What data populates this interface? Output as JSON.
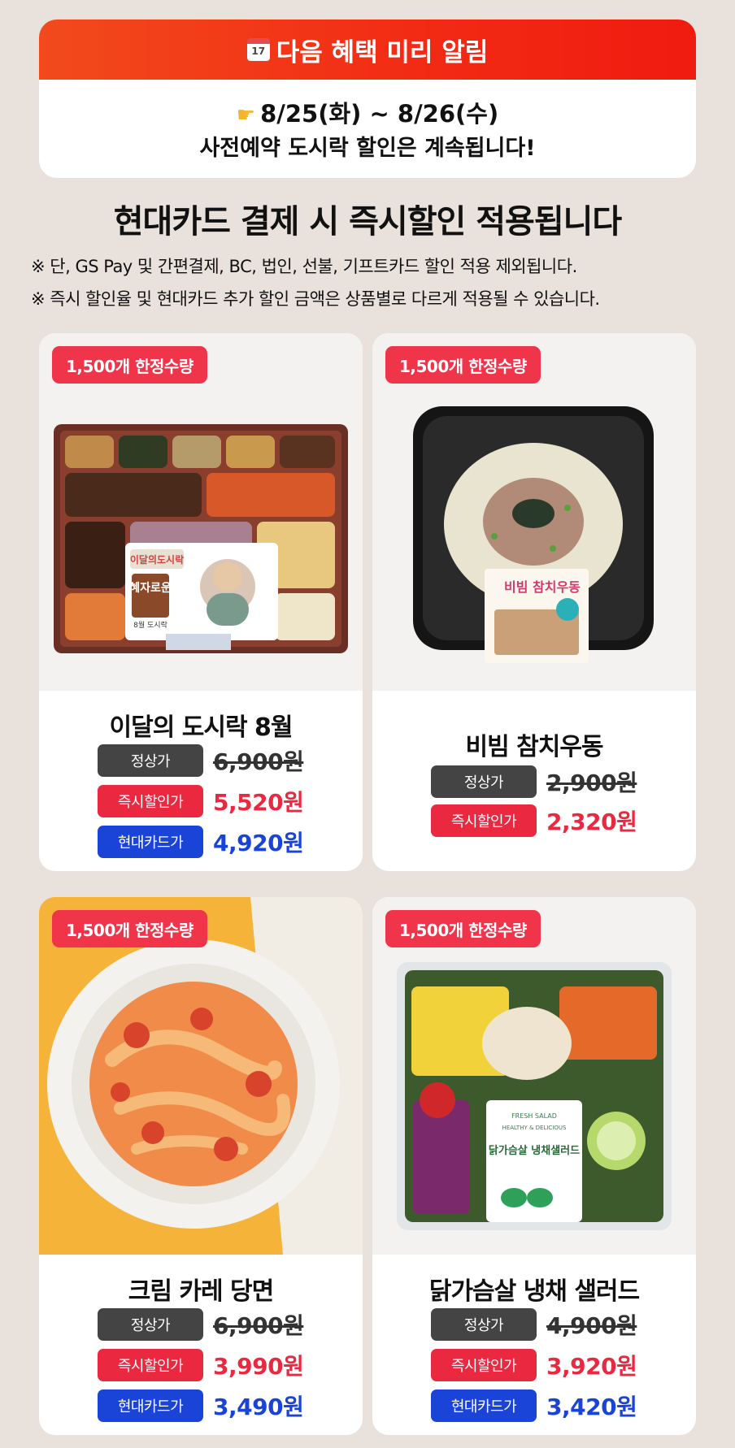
{
  "notice": {
    "title": "다음 혜택 미리 알림",
    "calendar_day": "17",
    "date_range": "8/25(화) ~ 8/26(수)",
    "message": "사전예약 도시락 할인은 계속됩니다!"
  },
  "headline": "현대카드 결제 시 즉시할인 적용됩니다",
  "notes": [
    "※ 단, GS Pay 및 간편결제, BC, 법인, 선불, 기프트카드 할인 적용 제외됩니다.",
    "※ 즉시 할인율 및 현대카드 추가 할인 금액은 상품별로 다르게 적용될 수 있습니다."
  ],
  "labels": {
    "regular": "정상가",
    "instant": "즉시할인가",
    "hyundai": "현대카드가"
  },
  "products": [
    {
      "badge": "1,500개 한정수량",
      "name": "이달의 도시락 8월",
      "regular_price": "6,900원",
      "instant_price": "5,520원",
      "card_price": "4,920원",
      "package_label": "혜자로운",
      "package_brand": "이달의도시락",
      "package_sub": "8월 도시락"
    },
    {
      "badge": "1,500개 한정수량",
      "name": "비빔 참치우동",
      "regular_price": "2,900원",
      "instant_price": "2,320원",
      "package_label": "비빔 참치우동"
    },
    {
      "badge": "1,500개 한정수량",
      "name": "크림 카레 당면",
      "regular_price": "6,900원",
      "instant_price": "3,990원",
      "card_price": "3,490원"
    },
    {
      "badge": "1,500개 한정수량",
      "name": "닭가슴살 냉채 샐러드",
      "regular_price": "4,900원",
      "instant_price": "3,920원",
      "card_price": "3,420원",
      "package_top": "FRESH SALAD",
      "package_sub": "HEALTHY & DELICIOUS",
      "package_label": "닭가슴살 냉채샐러드"
    }
  ],
  "colors": {
    "background": "#e9e2dc",
    "banner_red": "#f22a14",
    "badge_red": "#f0344a",
    "instant_red": "#ea2840",
    "card_blue": "#1a44d8",
    "regular_gray": "#444444"
  }
}
